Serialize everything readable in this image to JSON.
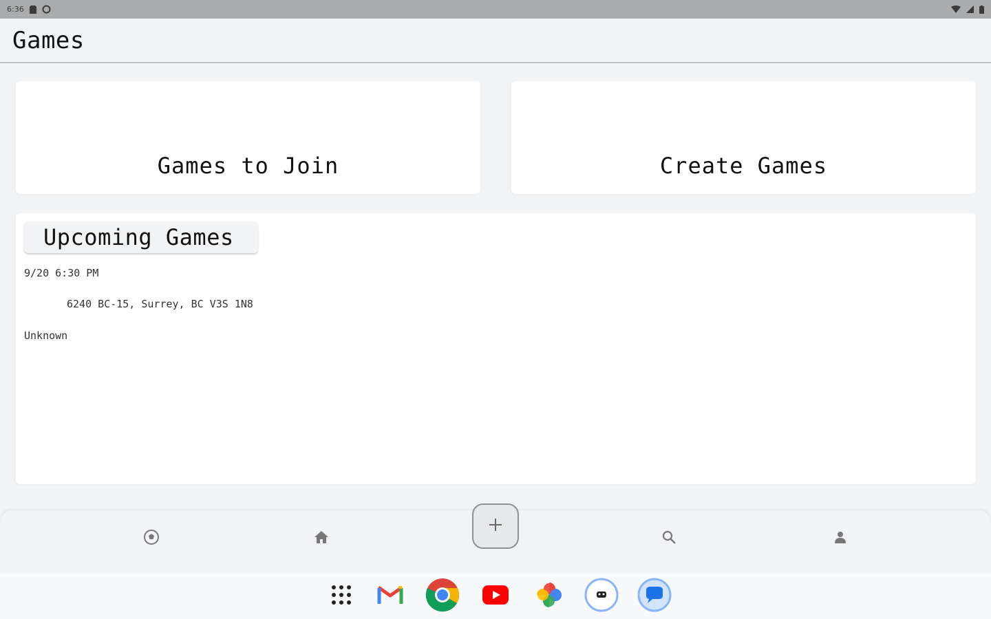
{
  "status_bar": {
    "time": "6:36",
    "icons": [
      "sd-card-icon",
      "sync-icon",
      "wifi-icon",
      "signal-icon",
      "battery-icon"
    ]
  },
  "app_bar": {
    "title": "Games"
  },
  "actions": {
    "join_label": "Games to Join",
    "create_label": "Create Games"
  },
  "upcoming": {
    "title": "Upcoming Games",
    "games": [
      {
        "date": "9/20 6:30 PM",
        "address": "6240 BC-15, Surrey, BC V3S 1N8",
        "status": "Unknown"
      }
    ]
  },
  "bottom_nav": {
    "items": [
      "soccer-ball-icon",
      "home-icon",
      "add-icon",
      "search-icon",
      "person-icon"
    ]
  },
  "dock": {
    "apps": [
      "app-grid-icon",
      "gmail-icon",
      "chrome-icon",
      "youtube-icon",
      "photos-icon",
      "app-icon",
      "messages-icon"
    ]
  },
  "colors": {
    "status_bar": "#a9abad",
    "background": "#f1f3f5",
    "card": "#ffffff"
  }
}
